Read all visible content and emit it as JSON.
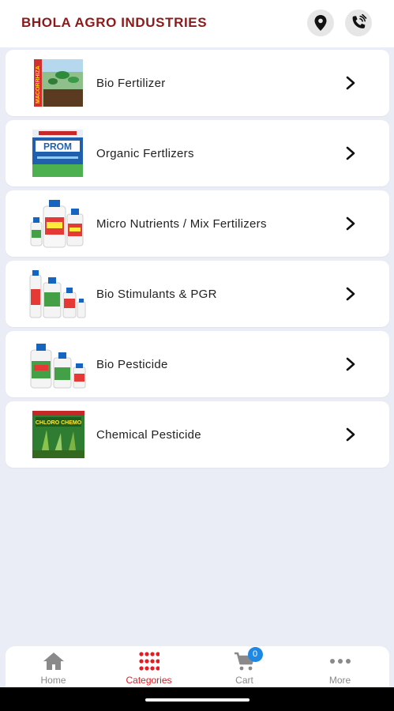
{
  "header": {
    "title": "BHOLA AGRO INDUSTRIES",
    "location_icon": "location-pin-icon",
    "call_icon": "phone-call-icon"
  },
  "categories": [
    {
      "label": "Bio Fertilizer",
      "image_text": "MACORRHIZA"
    },
    {
      "label": "Organic Fertlizers",
      "image_text": "PROM"
    },
    {
      "label": "Micro Nutrients / Mix Fertilizers"
    },
    {
      "label": "Bio Stimulants & PGR"
    },
    {
      "label": "Bio Pesticide"
    },
    {
      "label": "Chemical Pesticide",
      "image_text": "CHLORO CHEMO"
    }
  ],
  "bottom_nav": {
    "items": [
      {
        "label": "Home",
        "icon": "home-icon"
      },
      {
        "label": "Categories",
        "icon": "grid-dots-icon",
        "active": true
      },
      {
        "label": "Cart",
        "icon": "cart-icon",
        "badge": "0"
      },
      {
        "label": "More",
        "icon": "more-dots-icon"
      }
    ]
  },
  "colors": {
    "brand": "#8b1a1a",
    "active": "#e51c23",
    "badge": "#1e88e5",
    "background": "#eaecf6"
  }
}
